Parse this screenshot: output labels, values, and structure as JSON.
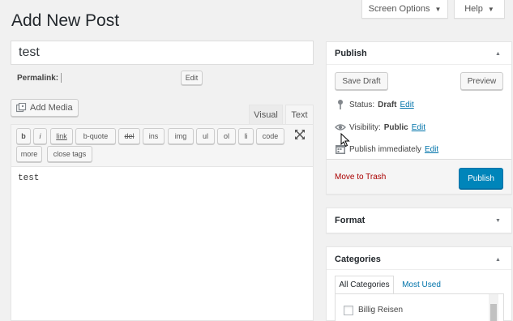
{
  "header": {
    "page_title": "Add New Post",
    "screen_options_label": "Screen Options",
    "help_label": "Help"
  },
  "post": {
    "title_value": "test",
    "permalink_label": "Permalink:",
    "permalink_edit_label": "Edit"
  },
  "editor": {
    "add_media_label": "Add Media",
    "tab_visual": "Visual",
    "tab_text": "Text",
    "active_tab": "Text",
    "quicktags": [
      "b",
      "i",
      "link",
      "b-quote",
      "del",
      "ins",
      "img",
      "ul",
      "ol",
      "li",
      "code",
      "more",
      "close tags"
    ],
    "content": "test"
  },
  "publish_box": {
    "title": "Publish",
    "save_draft_label": "Save Draft",
    "preview_label": "Preview",
    "status_label": "Status:",
    "status_value": "Draft",
    "visibility_label": "Visibility:",
    "visibility_value": "Public",
    "schedule_text": "Publish immediately",
    "edit_link": "Edit",
    "trash_label": "Move to Trash",
    "publish_label": "Publish"
  },
  "format_box": {
    "title": "Format"
  },
  "categories_box": {
    "title": "Categories",
    "tab_all": "All Categories",
    "tab_most_used": "Most Used",
    "items": [
      {
        "label": "Billig Reisen",
        "checked": false
      }
    ]
  },
  "colors": {
    "primary": "#0085ba",
    "link": "#0073aa",
    "delete": "#a00",
    "background": "#f1f1f1"
  }
}
